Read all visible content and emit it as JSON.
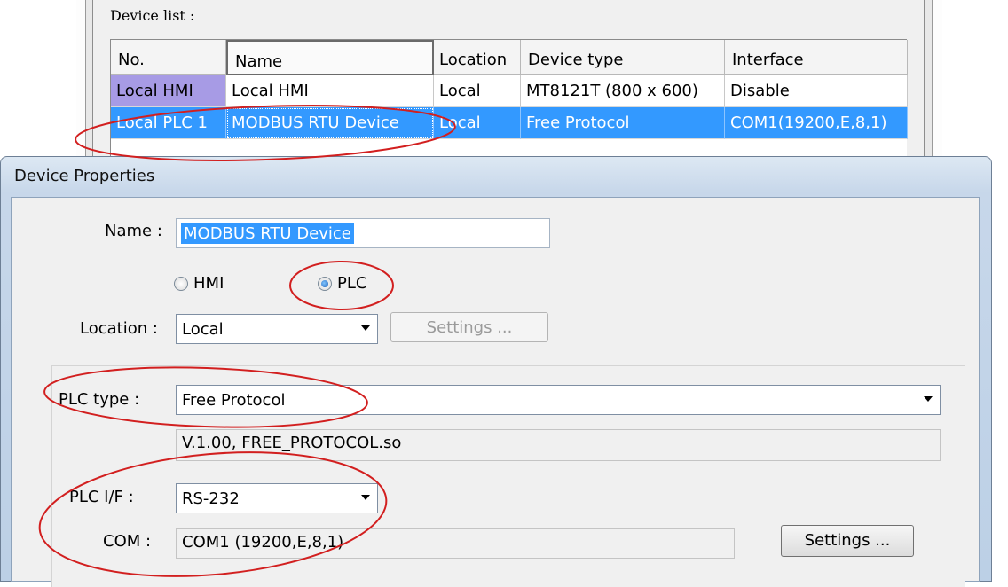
{
  "device_list": {
    "label": "Device list :",
    "columns": [
      "No.",
      "Name",
      "Location",
      "Device type",
      "Interface"
    ],
    "rows": [
      [
        "Local HMI",
        "Local HMI",
        "Local",
        "MT8121T (800 x 600)",
        "Disable"
      ],
      [
        "Local PLC 1",
        "MODBUS RTU Device",
        "Local",
        "Free Protocol",
        "COM1(19200,E,8,1)"
      ]
    ]
  },
  "dialog": {
    "title": "Device Properties",
    "name_label": "Name :",
    "name_value": "MODBUS RTU Device",
    "radio_hmi": "HMI",
    "radio_plc": "PLC",
    "location_label": "Location :",
    "location_value": "Local",
    "settings_disabled_label": "Settings ...",
    "plc_type_label": "PLC type :",
    "plc_type_value": "Free Protocol",
    "plc_version": "V.1.00, FREE_PROTOCOL.so",
    "plc_if_label": "PLC I/F :",
    "plc_if_value": "RS-232",
    "com_label": "COM :",
    "com_value": "COM1 (19200,E,8,1)",
    "com_settings_label": "Settings ..."
  },
  "colors": {
    "selection": "#3399ff",
    "hmi_cell": "#a79be5",
    "annotation": "#d21f1f"
  }
}
